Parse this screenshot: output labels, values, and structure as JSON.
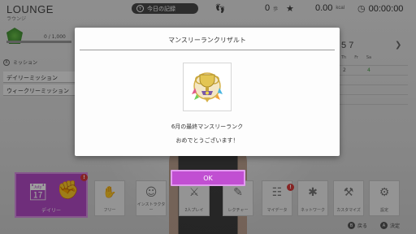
{
  "header": {
    "title": "LOUNGE",
    "subtitle": "ラウンジ",
    "records_button_glyph": "Y",
    "records_button_label": "今日の記録",
    "steps": {
      "value": "0",
      "unit": "歩"
    },
    "calories": {
      "value": "0.00",
      "unit": "kcal"
    },
    "time": "00:00:00"
  },
  "rank": {
    "progress_text": "0 / 1,000",
    "progress_fraction": 0.0
  },
  "missions": {
    "head_glyph": "X",
    "heading": "ミッション",
    "items": [
      "デイリーミッション",
      "ウィークリーミッション"
    ]
  },
  "calendar": {
    "month_visible": "5",
    "weekday_visible": [
      "7"
    ],
    "day_headers": [
      "Th",
      "Fr",
      "Sa"
    ],
    "visible_numbers": [
      "2",
      "4"
    ]
  },
  "menu": {
    "tiles": [
      {
        "label": "デイリー",
        "icon": "calendar-icon",
        "notify": true
      },
      {
        "label": "フリー",
        "icon": "boxing-gloves-icon"
      },
      {
        "label": "インストラクター",
        "icon": "instructor-icon"
      },
      {
        "label": "2人プレイ",
        "icon": "two-player-icon"
      },
      {
        "label": "レクチャー",
        "icon": "lecture-icon"
      },
      {
        "label": "マイデータ",
        "icon": "profile-card-icon",
        "notify": true
      },
      {
        "label": "ネットワーク",
        "icon": "network-icon"
      },
      {
        "label": "カスタマイズ",
        "icon": "wrench-icon"
      },
      {
        "label": "設定",
        "icon": "gear-icon"
      }
    ],
    "notify_glyph": "!"
  },
  "hints": [
    {
      "button": "B",
      "label": "戻る"
    },
    {
      "button": "A",
      "label": "決定"
    }
  ],
  "modal": {
    "title": "マンスリーランクリザルト",
    "line1": "6月の最終マンスリーランク",
    "line2": "おめでとうございます！",
    "ok_label": "OK",
    "trophy_icon": "trophy-icon"
  },
  "colors": {
    "accent": "#c14fd2",
    "notify": "#d93a3a",
    "rank_green": "#4aa63a"
  }
}
